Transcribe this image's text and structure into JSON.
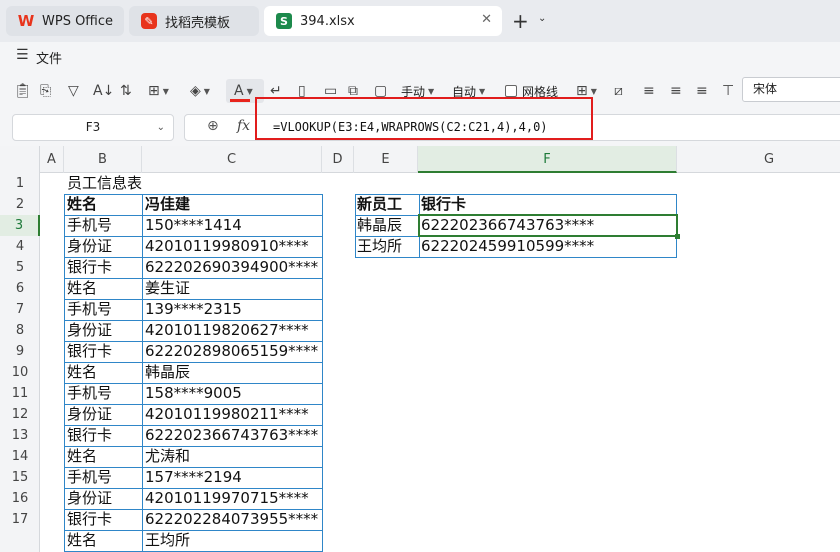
{
  "tabs": {
    "wps": "WPS Office",
    "templates": "找稻壳模板",
    "file": "394.xlsx"
  },
  "menu": {
    "file": "文件"
  },
  "toolbar": {
    "font_color_letter": "A",
    "manual_label": "手动",
    "auto_label": "自动",
    "gridlines_label": "网格线",
    "font_name": "宋体"
  },
  "formula_bar": {
    "cell_ref": "F3",
    "fx_label": "fx",
    "formula": "=VLOOKUP(E3:E4,WRAPROWS(C2:C21,4),4,0)"
  },
  "grid": {
    "columns": [
      "A",
      "B",
      "C",
      "D",
      "E",
      "F",
      "G"
    ],
    "active_column": "F",
    "active_row": 3,
    "rows": [
      1,
      2,
      3,
      4,
      5,
      6,
      7,
      8,
      9,
      10,
      11,
      12,
      13,
      14,
      15,
      16,
      17
    ],
    "title": "员工信息表",
    "left_table": [
      [
        "姓名",
        "冯佳建"
      ],
      [
        "手机号",
        "150****1414"
      ],
      [
        "身份证",
        "42010119980910****"
      ],
      [
        "银行卡",
        "622202690394900****"
      ],
      [
        "姓名",
        "姜生证"
      ],
      [
        "手机号",
        "139****2315"
      ],
      [
        "身份证",
        "42010119820627****"
      ],
      [
        "银行卡",
        "622202898065159****"
      ],
      [
        "姓名",
        "韩晶辰"
      ],
      [
        "手机号",
        "158****9005"
      ],
      [
        "身份证",
        "42010119980211****"
      ],
      [
        "银行卡",
        "622202366743763****"
      ],
      [
        "姓名",
        "尤涛和"
      ],
      [
        "手机号",
        "157****2194"
      ],
      [
        "身份证",
        "42010119970715****"
      ],
      [
        "银行卡",
        "622202284073955****"
      ],
      [
        "姓名",
        "王均所"
      ]
    ],
    "right_table": [
      [
        "新员工",
        "银行卡"
      ],
      [
        "韩晶辰",
        "622202366743763****"
      ],
      [
        "王均所",
        "622202459910599****"
      ]
    ]
  }
}
